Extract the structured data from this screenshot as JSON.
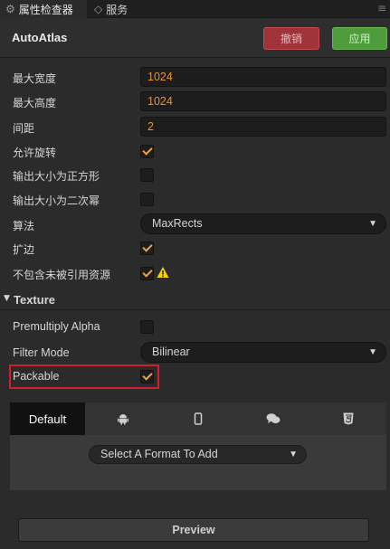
{
  "tabs": {
    "inspector_label": "属性检查器",
    "services_label": "服务",
    "menu_icon": "menu-icon"
  },
  "header": {
    "asset_name": "AutoAtlas",
    "revert_label": "撤销",
    "apply_label": "应用"
  },
  "properties": {
    "max_width": {
      "label": "最大宽度",
      "value": "1024"
    },
    "max_height": {
      "label": "最大高度",
      "value": "1024"
    },
    "padding": {
      "label": "间距",
      "value": "2"
    },
    "allow_rotation": {
      "label": "允许旋转",
      "checked": true
    },
    "force_squared": {
      "label": "输出大小为正方形",
      "checked": false
    },
    "power_of_two": {
      "label": "输出大小为二次幂",
      "checked": false
    },
    "algorithm": {
      "label": "算法",
      "value": "MaxRects"
    },
    "extrude": {
      "label": "扩边",
      "checked": true
    },
    "exclude_unused": {
      "label": "不包含未被引用资源",
      "checked": true,
      "warning": true
    }
  },
  "texture": {
    "section_title": "Texture",
    "premultiply_alpha": {
      "label": "Premultiply Alpha",
      "checked": false
    },
    "filter_mode": {
      "label": "Filter Mode",
      "value": "Bilinear"
    },
    "packable": {
      "label": "Packable",
      "checked": true
    }
  },
  "platforms": {
    "default_label": "Default",
    "icons": [
      "android-icon",
      "phone-icon",
      "chat-icon",
      "html5-icon"
    ],
    "format_placeholder": "Select A Format To Add"
  },
  "preview_label": "Preview",
  "colors": {
    "accent_orange": "#e8913a",
    "revert_red": "#a03239",
    "apply_green": "#4f9c3c",
    "highlight_red": "#d0202a"
  }
}
